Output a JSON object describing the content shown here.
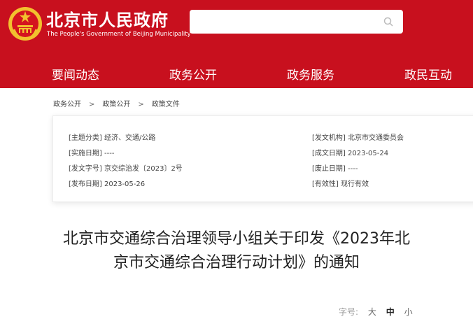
{
  "header": {
    "title": "北京市人民政府",
    "subtitle": "The People's Government of Beijing Municipality",
    "search": {
      "placeholder": "",
      "value": ""
    }
  },
  "nav": {
    "items": [
      "要闻动态",
      "政务公开",
      "政务服务",
      "政民互动"
    ]
  },
  "breadcrumb": {
    "items": [
      "政务公开",
      "政策公开",
      "政策文件"
    ],
    "separator": ">"
  },
  "meta": {
    "left": [
      {
        "label": "[主题分类]",
        "value": "经济、交通/公路"
      },
      {
        "label": "[实施日期]",
        "value": "----"
      },
      {
        "label": "[发文字号]",
        "value": "京交综治发〔2023〕2号"
      },
      {
        "label": "[发布日期]",
        "value": "2023-05-26"
      }
    ],
    "right": [
      {
        "label": "[发文机构]",
        "value": "北京市交通委员会"
      },
      {
        "label": "[成文日期]",
        "value": "2023-05-24"
      },
      {
        "label": "[废止日期]",
        "value": "----"
      },
      {
        "label": "[有效性]",
        "value": "现行有效"
      }
    ]
  },
  "document": {
    "title_line1": "北京市交通综合治理领导小组关于印发《2023年北",
    "title_line2": "京市交通综合治理行动计划》的通知"
  },
  "font_size": {
    "label": "字号:",
    "options": [
      "大",
      "中",
      "小"
    ],
    "selected": "中"
  },
  "colors": {
    "brand_red": "#c8101e",
    "emblem_gold": "#f2c12e"
  }
}
